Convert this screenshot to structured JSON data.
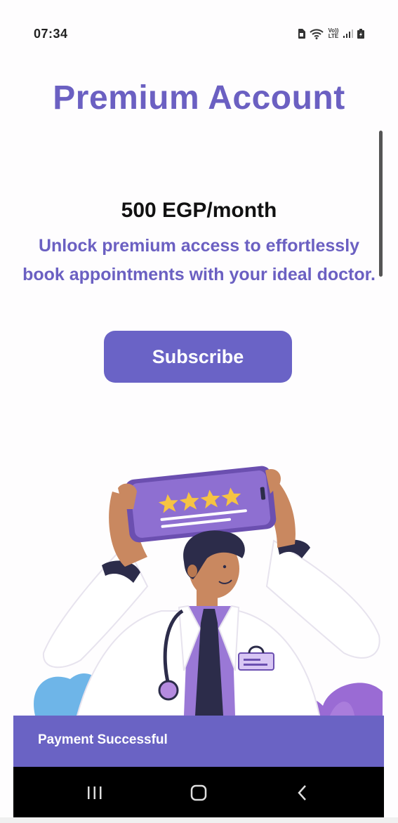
{
  "status_bar": {
    "time": "07:34",
    "icons": [
      "sim-card-icon",
      "wifi-icon",
      "volte-lte-icon",
      "signal-icon",
      "battery-icon"
    ],
    "volte_label": "Vo)) LTE"
  },
  "page": {
    "title": "Premium Account",
    "price": "500 EGP/month",
    "tagline": "Unlock premium access to effortlessly book appointments with your ideal doctor.",
    "subscribe_label": "Subscribe"
  },
  "illustration": {
    "description_icon": "doctor-holding-phone-rating-illustration",
    "stars": 4
  },
  "snackbar": {
    "message": "Payment Successful"
  },
  "nav_bar": {
    "buttons": [
      "recent-apps-icon",
      "home-icon",
      "back-icon"
    ]
  },
  "colors": {
    "accent": "#6b60c2",
    "button": "#6a63c6",
    "snackbar": "#6a63c4",
    "nav": "#000000"
  }
}
